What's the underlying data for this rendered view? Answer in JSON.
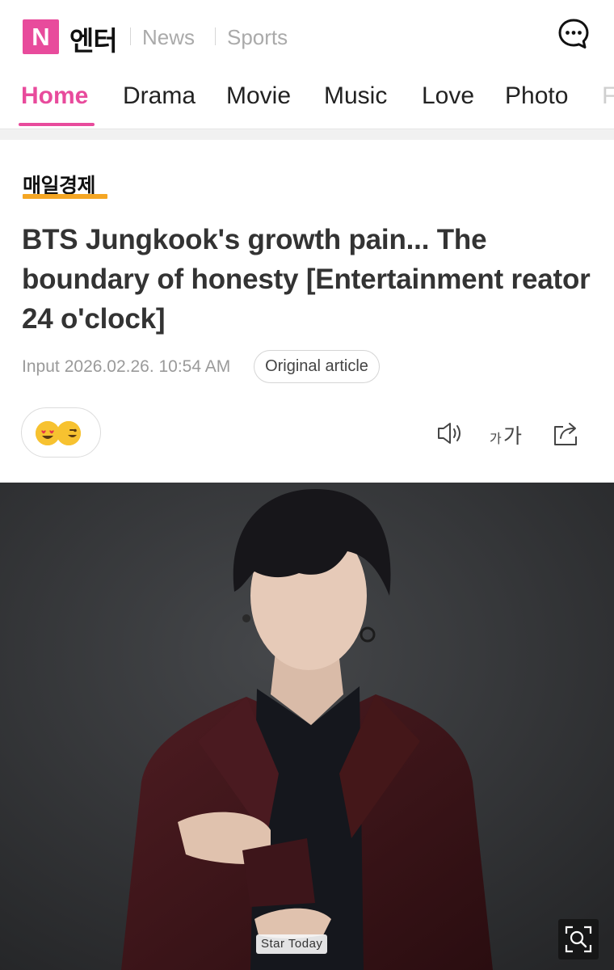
{
  "header": {
    "logo_letter": "N",
    "logo_text": "엔터",
    "links": [
      "News",
      "Sports"
    ],
    "chat_icon": "chat-bubble-dots-icon"
  },
  "tabs": [
    {
      "label": "Home",
      "active": true
    },
    {
      "label": "Drama",
      "active": false
    },
    {
      "label": "Movie",
      "active": false
    },
    {
      "label": "Music",
      "active": false
    },
    {
      "label": "Love",
      "active": false
    },
    {
      "label": "Photo",
      "active": false
    },
    {
      "label": "F",
      "active": false
    }
  ],
  "article": {
    "press": "매일경제",
    "headline": "BTS Jungkook's growth pain... The boundary of honesty [Entertainment reator 24 o'clock]",
    "input_label": "Input",
    "input_datetime": "2026.02.26. 10:54 AM",
    "original_button": "Original article",
    "reactions_icon": "emoji-reactions-icon",
    "tools": [
      "speaker-icon",
      "font-size-icon",
      "share-icon"
    ],
    "font_small": "가",
    "font_big": "가"
  },
  "photo": {
    "credit": "Star Today",
    "zoom_icon": "zoom-search-icon"
  },
  "colors": {
    "brand": "#e84b9c",
    "press_underline": "#f5a623",
    "background": "#ffffff"
  }
}
